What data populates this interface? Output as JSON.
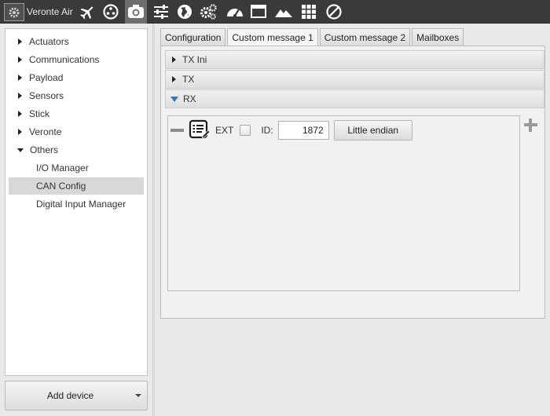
{
  "app": {
    "title": "Veronte Air"
  },
  "toolbar": {
    "icons": [
      "app-gear-logo",
      "airplane-icon",
      "joystick-icon",
      "camera-icon",
      "sliders-icon",
      "globe-icon",
      "gears-icon",
      "gauge-icon",
      "window-icon",
      "mountains-icon",
      "grid-icon",
      "forbidden-icon"
    ],
    "active_icon": "camera-icon"
  },
  "sidebar": {
    "items": [
      {
        "label": "Actuators",
        "expanded": false
      },
      {
        "label": "Communications",
        "expanded": false
      },
      {
        "label": "Payload",
        "expanded": false
      },
      {
        "label": "Sensors",
        "expanded": false
      },
      {
        "label": "Stick",
        "expanded": false
      },
      {
        "label": "Veronte",
        "expanded": false
      },
      {
        "label": "Others",
        "expanded": true
      }
    ],
    "children": [
      {
        "label": "I/O Manager",
        "selected": false
      },
      {
        "label": "CAN Config",
        "selected": true
      },
      {
        "label": "Digital Input Manager",
        "selected": false
      }
    ],
    "add_device_label": "Add device"
  },
  "tabs": [
    {
      "label": "Configuration",
      "active": false
    },
    {
      "label": "Custom message 1",
      "active": true
    },
    {
      "label": "Custom message 2",
      "active": false
    },
    {
      "label": "Mailboxes",
      "active": false
    }
  ],
  "sections": [
    {
      "label": "TX Ini",
      "expanded": false
    },
    {
      "label": "TX",
      "expanded": false
    },
    {
      "label": "RX",
      "expanded": true
    }
  ],
  "rx_row": {
    "ext_label": "EXT",
    "ext_checked": false,
    "id_label": "ID:",
    "id_value": "1872",
    "endian_label": "Little endian"
  },
  "colors": {
    "toolbar_bg": "#3a3a3a",
    "accent_arrow": "#2a7cc4",
    "selected_bg": "#d8d8d8"
  }
}
